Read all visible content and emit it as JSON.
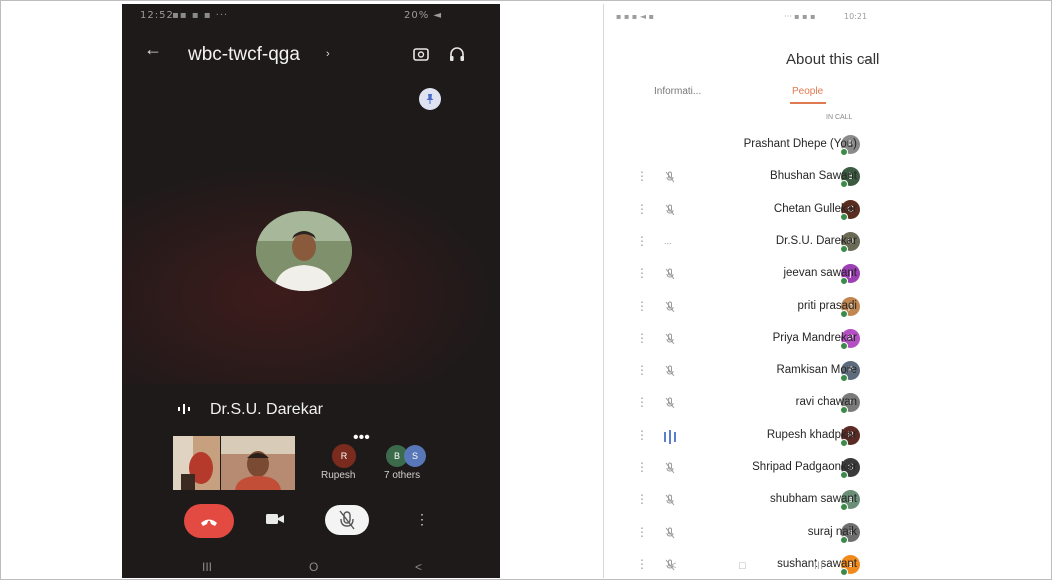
{
  "left_phone": {
    "status_time": "12:52",
    "status_right": "20% ◄",
    "meeting_code": "wbc-twcf-qga",
    "active_speaker": "Dr.S.U. Darekar",
    "participant_label": "Rupesh",
    "participant_initial": "R",
    "others_label": "7 others",
    "others_initials": [
      "B",
      "S"
    ],
    "nav": [
      "III",
      "O",
      "<"
    ]
  },
  "right_phone": {
    "status_left": "10:21",
    "title": "About this call",
    "tabs": {
      "people": "People",
      "info": "Informati..."
    },
    "section_label": "IN CALL",
    "participants": [
      {
        "name": "Prashant Dhepe (You)",
        "initial": "P",
        "color": "#8a8a8a",
        "status": "",
        "kebab": ""
      },
      {
        "name": "Bhushan Sawant",
        "initial": "B",
        "color": "#3b5a40",
        "status": "mic-off",
        "kebab": "⋮"
      },
      {
        "name": "Chetan Gullekar",
        "initial": "C",
        "color": "#5a2d1f",
        "status": "mic-off",
        "kebab": "⋮"
      },
      {
        "name": "Dr.S.U. Darekar",
        "initial": "D",
        "color": "#6a6a55",
        "status": "...",
        "kebab": "⋮"
      },
      {
        "name": "jeevan sawant",
        "initial": "j",
        "color": "#9c3fb4",
        "status": "mic-off",
        "kebab": "⋮"
      },
      {
        "name": "priti prasadi",
        "initial": "p",
        "color": "#c08752",
        "status": "mic-off",
        "kebab": "⋮"
      },
      {
        "name": "Priya Mandrekar",
        "initial": "P",
        "color": "#b34fc2",
        "status": "mic-off",
        "kebab": "⋮"
      },
      {
        "name": "Ramkisan More",
        "initial": "R",
        "color": "#5e6b7c",
        "status": "mic-off",
        "kebab": "⋮"
      },
      {
        "name": "ravi chawan",
        "initial": "r",
        "color": "#7a7a7a",
        "status": "mic-off",
        "kebab": "⋮"
      },
      {
        "name": "Rupesh khadpkar",
        "initial": "R",
        "color": "#5a2a24",
        "status": "speaking",
        "kebab": "⋮"
      },
      {
        "name": "Shripad Padgaonkar",
        "initial": "S",
        "color": "#3a3a3a",
        "status": "mic-off",
        "kebab": "⋮"
      },
      {
        "name": "shubham sawant",
        "initial": "s",
        "color": "#6b8e78",
        "status": "mic-off",
        "kebab": "⋮"
      },
      {
        "name": "suraj naik",
        "initial": "s",
        "color": "#6f6f6f",
        "status": "mic-off",
        "kebab": "⋮"
      },
      {
        "name": "sushant sawant",
        "initial": "s",
        "color": "#f08a1c",
        "status": "mic-off",
        "kebab": "⋮"
      }
    ],
    "nav": [
      "<",
      "□",
      "III"
    ]
  }
}
